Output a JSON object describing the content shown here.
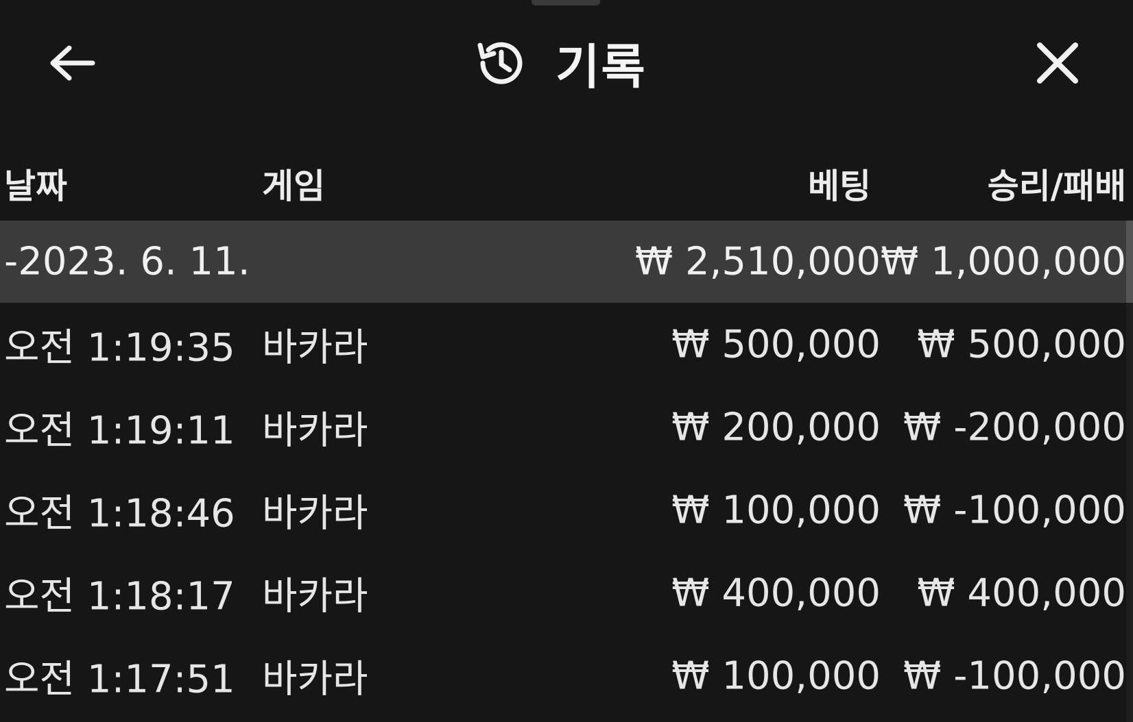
{
  "header": {
    "title": "기록",
    "back_icon": "arrow-left-icon",
    "history_icon": "history-icon",
    "close_icon": "close-icon"
  },
  "table": {
    "columns": [
      "날짜",
      "게임",
      "베팅",
      "승리/패배"
    ],
    "date_group": {
      "date": "-2023. 6. 11.",
      "bet_total": "₩ 2,510,000",
      "result_total": "₩ 1,000,000"
    },
    "rows": [
      {
        "time": "오전 1:19:35",
        "game": "바카라",
        "bet": "₩ 500,000",
        "result": "₩ 500,000"
      },
      {
        "time": "오전 1:19:11",
        "game": "바카라",
        "bet": "₩ 200,000",
        "result": "₩ -200,000"
      },
      {
        "time": "오전 1:18:46",
        "game": "바카라",
        "bet": "₩ 100,000",
        "result": "₩ -100,000"
      },
      {
        "time": "오전 1:18:17",
        "game": "바카라",
        "bet": "₩ 400,000",
        "result": "₩ 400,000"
      },
      {
        "time": "오전 1:17:51",
        "game": "바카라",
        "bet": "₩ 100,000",
        "result": "₩ -100,000"
      }
    ]
  },
  "colors": {
    "background": "#161616",
    "date_row_bg": "#3b3b3b",
    "text": "#f2f2f2"
  }
}
